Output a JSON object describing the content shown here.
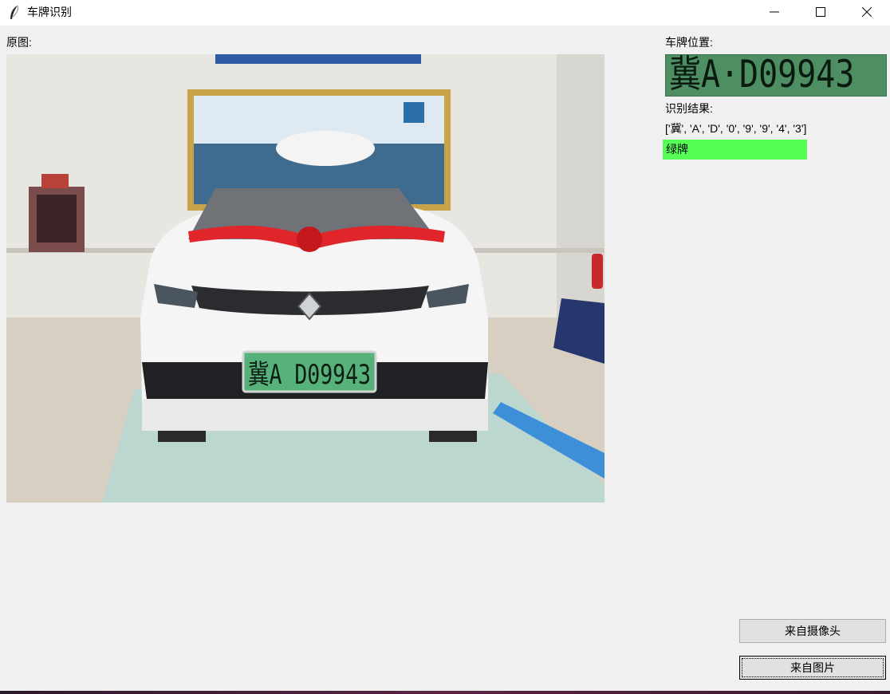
{
  "window": {
    "title": "车牌识别"
  },
  "labels": {
    "original": "原图:",
    "plate_location": "车牌位置:",
    "result": "识别结果:"
  },
  "plate": {
    "crop_text": "冀A·D09943",
    "photo_plate_text": "冀A D09943"
  },
  "recognition": {
    "chars_text": "['冀', 'A', 'D', '0', '9', '9', '4', '3']",
    "color_label": "绿牌",
    "color_hex": "#55ff55"
  },
  "buttons": {
    "camera": "来自摄像头",
    "image": "来自图片"
  },
  "icons": {
    "app": "feather-icon",
    "minimize": "minimize-icon",
    "maximize": "maximize-icon",
    "close": "close-icon"
  }
}
